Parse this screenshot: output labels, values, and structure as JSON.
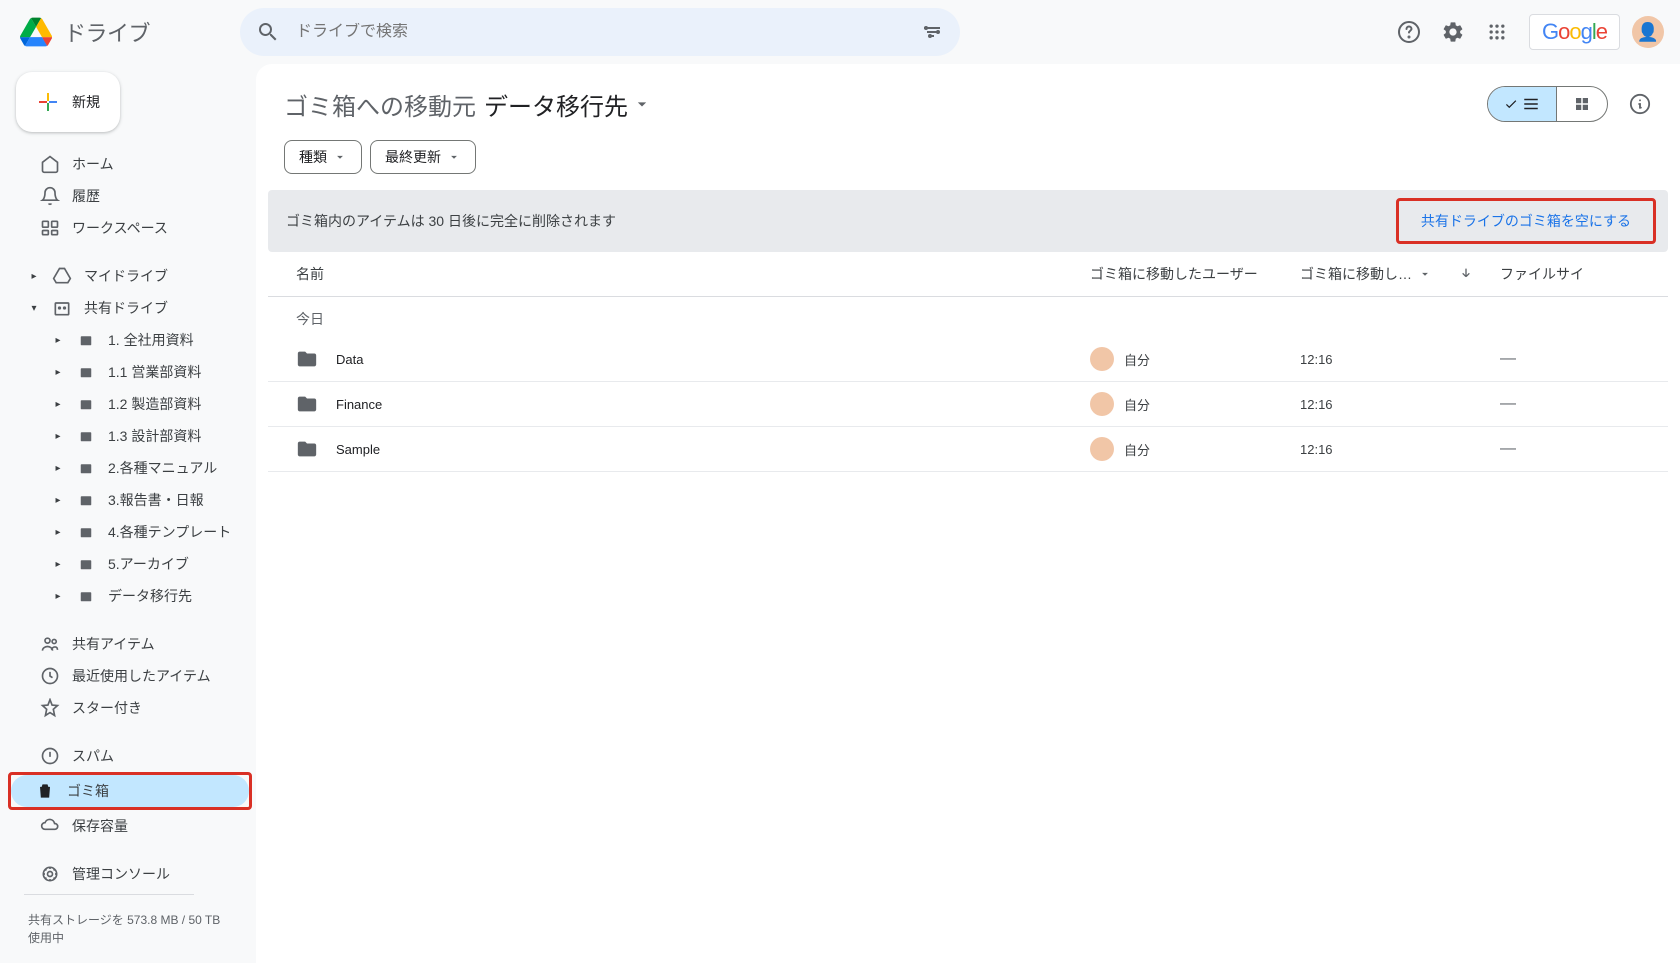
{
  "app": {
    "name": "ドライブ"
  },
  "search": {
    "placeholder": "ドライブで検索"
  },
  "header": {
    "google": "Google"
  },
  "sidebar": {
    "new_label": "新規",
    "nav1": [
      {
        "label": "ホーム"
      },
      {
        "label": "履歴"
      },
      {
        "label": "ワークスペース"
      }
    ],
    "my_drive": "マイドライブ",
    "shared_drive": "共有ドライブ",
    "shared_children": [
      {
        "label": "1. 全社用資料"
      },
      {
        "label": "1.1 営業部資料"
      },
      {
        "label": "1.2 製造部資料"
      },
      {
        "label": "1.3 設計部資料"
      },
      {
        "label": "2.各種マニュアル"
      },
      {
        "label": "3.報告書・日報"
      },
      {
        "label": "4.各種テンプレート"
      },
      {
        "label": "5.アーカイブ"
      },
      {
        "label": "データ移行先"
      }
    ],
    "nav2": [
      {
        "label": "共有アイテム"
      },
      {
        "label": "最近使用したアイテム"
      },
      {
        "label": "スター付き"
      }
    ],
    "nav3": [
      {
        "label": "スパム"
      },
      {
        "label": "ゴミ箱"
      },
      {
        "label": "保存容量"
      }
    ],
    "admin": "管理コンソール",
    "storage": "共有ストレージを 573.8 MB / 50 TB 使用中"
  },
  "breadcrumb": {
    "prefix": "ゴミ箱への移動元",
    "current": "データ移行先"
  },
  "filters": {
    "type": "種類",
    "modified": "最終更新"
  },
  "banner": {
    "text": "ゴミ箱内のアイテムは 30 日後に完全に削除されます",
    "action": "共有ドライブのゴミ箱を空にする"
  },
  "table": {
    "headers": {
      "name": "名前",
      "user": "ゴミ箱に移動したユーザー",
      "date": "ゴミ箱に移動し…",
      "size": "ファイルサイ"
    },
    "section": "今日",
    "rows": [
      {
        "name": "Data",
        "user": "自分",
        "date": "12:16",
        "size": "—"
      },
      {
        "name": "Finance",
        "user": "自分",
        "date": "12:16",
        "size": "—"
      },
      {
        "name": "Sample",
        "user": "自分",
        "date": "12:16",
        "size": "—"
      }
    ]
  }
}
